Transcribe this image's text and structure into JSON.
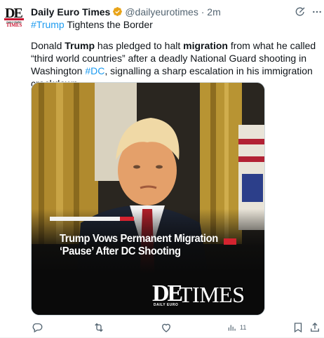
{
  "author": {
    "display_name": "Daily Euro Times",
    "handle": "@dailyeurotimes",
    "separator": "·",
    "time": "2m",
    "avatar": {
      "mark": "DE",
      "line1": "DAILY EURO",
      "line2": "TIMES"
    }
  },
  "post": {
    "hashtag": "#Trump",
    "headline_rest": " Tightens the Border",
    "body": {
      "part1": "Donald ",
      "bold1": "Trump",
      "part2": " has pledged to halt ",
      "bold2": "migration",
      "part3": " from what he called “third world countries” after a deadly National Guard shooting in Washington ",
      "hashtag": "#DC",
      "part4": ", signalling a sharp escalation in his immigration crackdown."
    }
  },
  "media": {
    "overlay_line1": "Trump Vows Permanent Migration",
    "overlay_line2": "‘Pause’ After DC Shooting",
    "logo_mark": "DE",
    "logo_word": "TIMES",
    "logo_sub": "DAILY EURO"
  },
  "actions": {
    "reply_count": "",
    "repost_count": "",
    "like_count": "",
    "views_count": "11"
  },
  "colors": {
    "accent": "#1d9bf0",
    "verified": "#e8a317",
    "secondary_text": "#536471",
    "brand_red": "#c8102e"
  },
  "icons": [
    "grok-icon",
    "more-icon",
    "verified-badge-icon",
    "reply-icon",
    "repost-icon",
    "like-icon",
    "views-icon",
    "bookmark-icon",
    "share-icon"
  ]
}
